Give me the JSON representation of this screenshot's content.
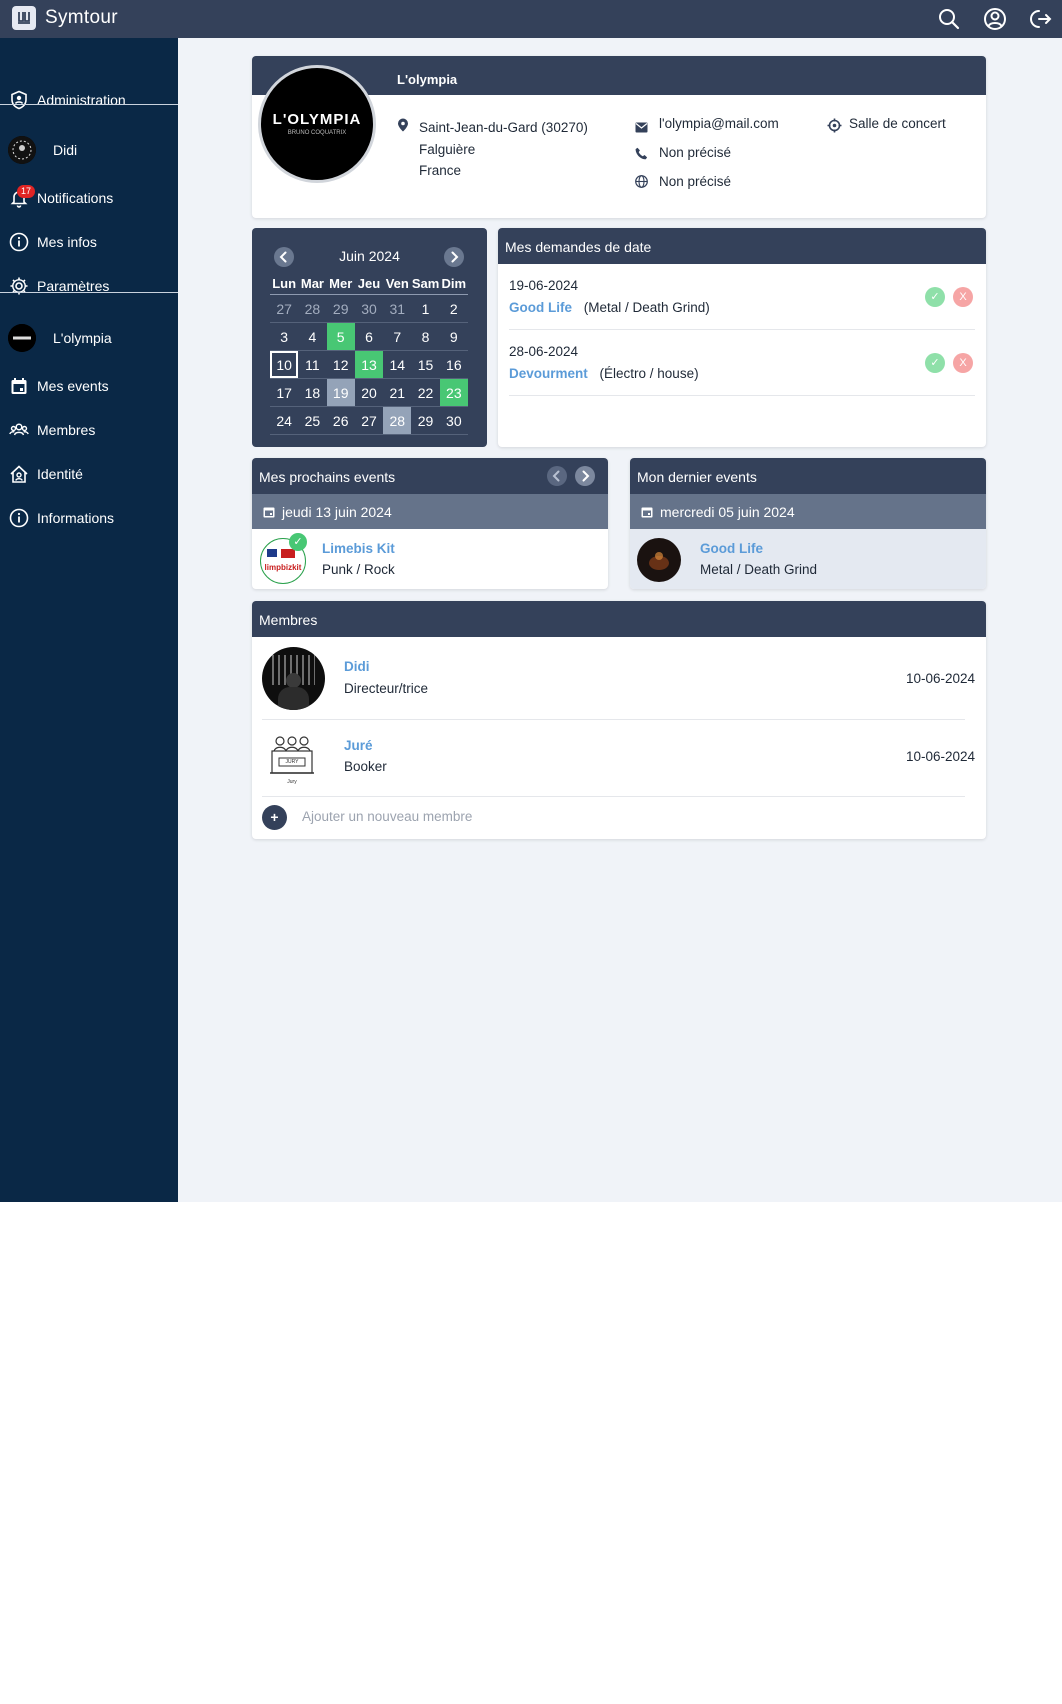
{
  "app": {
    "name": "Symtour"
  },
  "sidebar": {
    "items": [
      {
        "label": "Administration"
      },
      {
        "label": "Didi"
      },
      {
        "label": "Notifications",
        "badge": "17"
      },
      {
        "label": "Mes infos"
      },
      {
        "label": "Paramètres"
      },
      {
        "label": "L'olympia"
      },
      {
        "label": "Mes events"
      },
      {
        "label": "Membres"
      },
      {
        "label": "Identité"
      },
      {
        "label": "Informations"
      }
    ]
  },
  "venue": {
    "name": "L'olympia",
    "logo_text": "L'OLYMPIA",
    "logo_sub": "BRUNO COQUATRIX",
    "address": [
      "Saint-Jean-du-Gard (30270)",
      "Falguière",
      "France"
    ],
    "email": "l'olympia@mail.com",
    "phone": "Non précisé",
    "website": "Non précisé",
    "type": "Salle de concert"
  },
  "calendar": {
    "month": "Juin 2024",
    "days": [
      "Lun",
      "Mar",
      "Mer",
      "Jeu",
      "Ven",
      "Sam",
      "Dim"
    ],
    "weeks": [
      [
        "27",
        "28",
        "29",
        "30",
        "31",
        "1",
        "2"
      ],
      [
        "3",
        "4",
        "5",
        "6",
        "7",
        "8",
        "9"
      ],
      [
        "10",
        "11",
        "12",
        "13",
        "14",
        "15",
        "16"
      ],
      [
        "17",
        "18",
        "19",
        "20",
        "21",
        "22",
        "23"
      ],
      [
        "24",
        "25",
        "26",
        "27",
        "28",
        "29",
        "30"
      ]
    ],
    "highlight_green": [
      "5",
      "13",
      "23"
    ],
    "highlight_grey": [
      "19",
      "28"
    ],
    "today": "10"
  },
  "requests": {
    "title": "Mes demandes de date",
    "items": [
      {
        "date": "19-06-2024",
        "artist": "Good Life",
        "genre": "(Metal / Death Grind)",
        "accept": "✓",
        "reject": "X"
      },
      {
        "date": "28-06-2024",
        "artist": "Devourment",
        "genre": "(Électro / house)",
        "accept": "✓",
        "reject": "X"
      }
    ]
  },
  "upcoming": {
    "title": "Mes prochains events",
    "date": "jeudi 13 juin 2024",
    "artist": "Limebis Kit",
    "genre": "Punk / Rock",
    "thumb_text": "limpbizkit",
    "check": "✓"
  },
  "last": {
    "title": "Mon dernier events",
    "date": "mercredi 05 juin 2024",
    "artist": "Good Life",
    "genre": "Metal / Death Grind"
  },
  "members": {
    "title": "Membres",
    "items": [
      {
        "name": "Didi",
        "role": "Directeur/trice",
        "date": "10-06-2024"
      },
      {
        "name": "Juré",
        "role": "Booker",
        "date": "10-06-2024",
        "sign": "JURY",
        "caption": "Jury"
      }
    ],
    "add_label": "Ajouter un nouveau membre",
    "add_symbol": "+"
  },
  "colors": {
    "header": "#34415a",
    "sidebar": "#0a2846",
    "accent": "#5b9bd8",
    "green": "#48c774",
    "red": "#f87171"
  }
}
